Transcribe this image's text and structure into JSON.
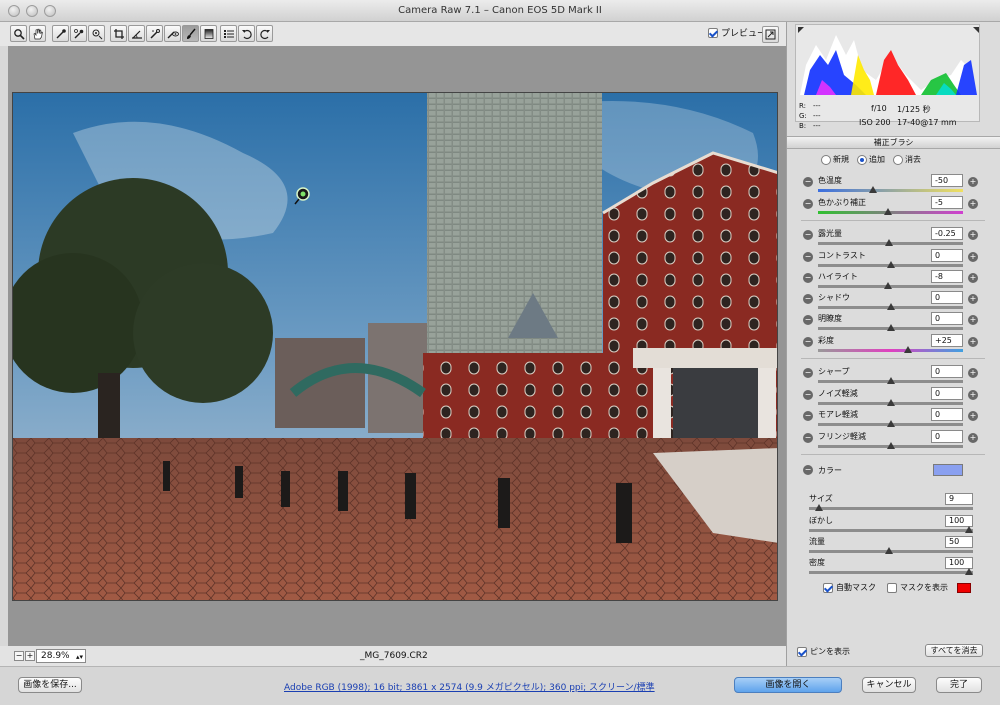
{
  "window": {
    "title": "Camera Raw 7.1  –  Canon EOS 5D Mark II"
  },
  "toolbar": {
    "tools": [
      "zoom-icon",
      "hand-icon",
      "white-balance-icon",
      "color-sampler-icon",
      "target-adjust-icon",
      "crop-icon",
      "straighten-icon",
      "spot-removal-icon",
      "red-eye-icon",
      "adjustment-brush-icon",
      "graduated-filter-icon",
      "preferences-icon",
      "rotate-ccw-icon",
      "rotate-cw-icon"
    ],
    "preview_label": "プレビュー",
    "preview_checked": true
  },
  "histogram": {
    "r_label": "R:",
    "g_label": "G:",
    "b_label": "B:",
    "r_value": "---",
    "g_value": "---",
    "b_value": "---",
    "aperture": "f/10",
    "shutter": "1/125 秒",
    "iso": "ISO 200",
    "lens": "17-40@17 mm"
  },
  "brush_panel": {
    "title": "補正ブラシ",
    "modes": [
      {
        "label": "新規",
        "selected": false
      },
      {
        "label": "追加",
        "selected": true
      },
      {
        "label": "消去",
        "selected": false
      }
    ],
    "sliders": [
      {
        "label": "色温度",
        "value": "-50",
        "level": 0.38
      },
      {
        "label": "色かぶり補正",
        "value": "-5",
        "level": 0.48
      },
      {
        "label": "露光量",
        "value": "-0.25",
        "level": 0.49
      },
      {
        "label": "コントラスト",
        "value": "0",
        "level": 0.5
      },
      {
        "label": "ハイライト",
        "value": "-8",
        "level": 0.48
      },
      {
        "label": "シャドウ",
        "value": "0",
        "level": 0.5
      },
      {
        "label": "明瞭度",
        "value": "0",
        "level": 0.5
      },
      {
        "label": "彩度",
        "value": "+25",
        "level": 0.62
      },
      {
        "label": "シャープ",
        "value": "0",
        "level": 0.5
      },
      {
        "label": "ノイズ軽減",
        "value": "0",
        "level": 0.5
      },
      {
        "label": "モアレ軽減",
        "value": "0",
        "level": 0.5
      },
      {
        "label": "フリンジ軽減",
        "value": "0",
        "level": 0.5
      }
    ],
    "color_label": "カラー",
    "color_value": "#8aa0f0",
    "brush_settings": [
      {
        "label": "サイズ",
        "value": "9",
        "level": 0.06
      },
      {
        "label": "ぼかし",
        "value": "100",
        "level": 1.0
      },
      {
        "label": "流量",
        "value": "50",
        "level": 0.5
      },
      {
        "label": "密度",
        "value": "100",
        "level": 1.0
      }
    ],
    "auto_mask_label": "自動マスク",
    "auto_mask_checked": true,
    "show_mask_label": "マスクを表示",
    "show_mask_checked": false,
    "mask_color": "#f00000",
    "show_pins_label": "ピンを表示",
    "show_pins_checked": true,
    "clear_all_label": "すべてを消去"
  },
  "status": {
    "zoom": "28.9%",
    "filename": "_MG_7609.CR2"
  },
  "footer": {
    "save_label": "画像を保存...",
    "workflow_link": "Adobe RGB (1998); 16 bit; 3861 x 2574 (9.9 メガピクセル); 360 ppi; スクリーン/標準",
    "open_label": "画像を開く",
    "cancel_label": "キャンセル",
    "done_label": "完了"
  },
  "colors": {
    "accent": "#1a52c9",
    "primary_button": "#5fa3ec"
  }
}
